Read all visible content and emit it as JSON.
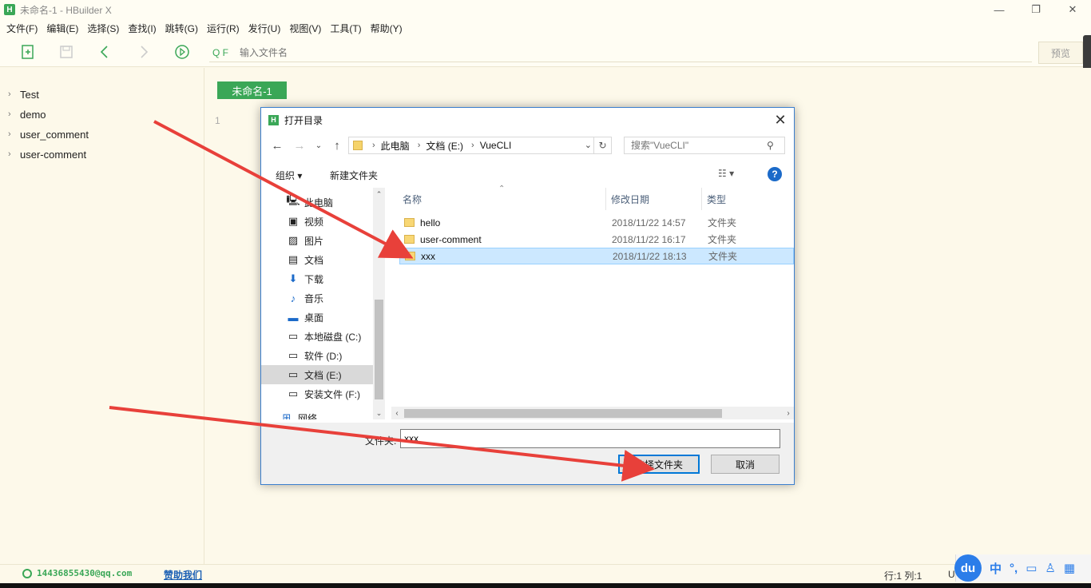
{
  "window": {
    "title": "未命名-1 - HBuilder X",
    "logo": "H",
    "controls": [
      "—",
      "❐",
      "✕"
    ]
  },
  "menu": [
    "文件(F)",
    "编辑(E)",
    "选择(S)",
    "查找(I)",
    "跳转(G)",
    "运行(R)",
    "发行(U)",
    "视图(V)",
    "工具(T)",
    "帮助(Y)"
  ],
  "toolbar": {
    "search_prefix": "Q F",
    "search_placeholder": "输入文件名",
    "preview_label": "预览"
  },
  "projects": [
    "Test",
    "demo",
    "user_comment",
    "user-comment"
  ],
  "editor": {
    "tab_label": "未命名-1",
    "line_number": "1"
  },
  "status": {
    "email": "14436855430@qq.com",
    "sponsor": "赞助我们",
    "position": "行:1    列:1",
    "encoding": "U"
  },
  "ime": {
    "logo": "du",
    "lang": "中",
    "punct": "°,"
  },
  "dialog": {
    "logo": "H",
    "title": "打开目录",
    "breadcrumb": [
      "此电脑",
      "文档 (E:)",
      "VueCLI"
    ],
    "search_placeholder": "搜索\"VueCLI\"",
    "organize_label": "组织 ▾",
    "new_folder_label": "新建文件夹",
    "nav_items": [
      {
        "label": "此电脑",
        "icon": "computer-icon"
      },
      {
        "label": "视频",
        "icon": "video-icon"
      },
      {
        "label": "图片",
        "icon": "picture-icon"
      },
      {
        "label": "文档",
        "icon": "document-icon"
      },
      {
        "label": "下载",
        "icon": "download-icon"
      },
      {
        "label": "音乐",
        "icon": "music-icon"
      },
      {
        "label": "桌面",
        "icon": "desktop-icon"
      },
      {
        "label": "本地磁盘 (C:)",
        "icon": "drive-icon"
      },
      {
        "label": "软件 (D:)",
        "icon": "drive-icon"
      },
      {
        "label": "文档 (E:)",
        "icon": "drive-icon",
        "selected": true
      },
      {
        "label": "安装文件 (F:)",
        "icon": "drive-icon"
      },
      {
        "label": "网络",
        "icon": "network-icon"
      }
    ],
    "columns": [
      "名称",
      "修改日期",
      "类型"
    ],
    "files": [
      {
        "name": "hello",
        "date": "2018/11/22 14:57",
        "type": "文件夹"
      },
      {
        "name": "user-comment",
        "date": "2018/11/22 16:17",
        "type": "文件夹"
      },
      {
        "name": "xxx",
        "date": "2018/11/22 18:13",
        "type": "文件夹",
        "selected": true
      }
    ],
    "folder_label": "文件夹:",
    "folder_value": "xxx",
    "select_button": "选择文件夹",
    "cancel_button": "取消"
  },
  "colors": {
    "accent_green": "#3aa757",
    "arrow_red": "#e8403a",
    "selection_blue": "#cce8ff"
  }
}
